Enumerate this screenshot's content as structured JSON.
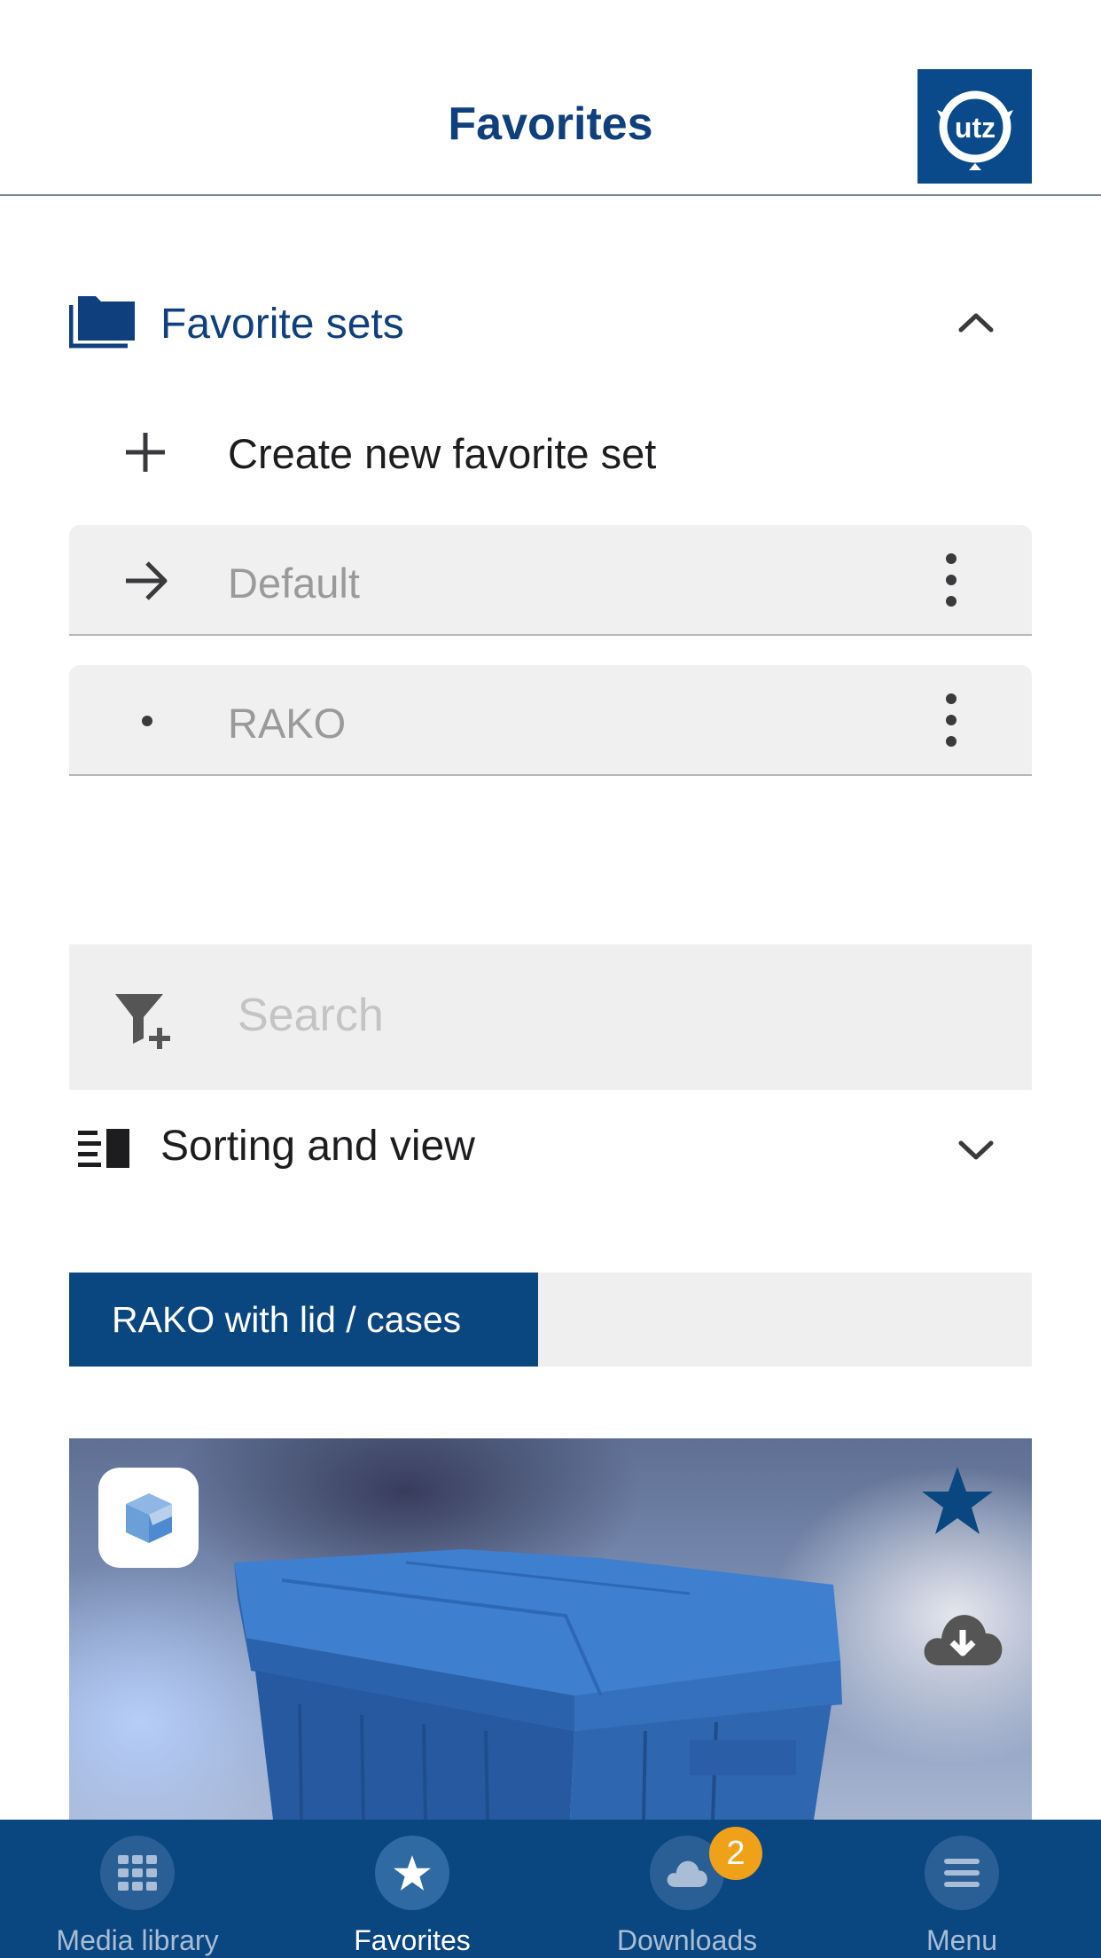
{
  "header": {
    "title": "Favorites",
    "logo_text": "utz"
  },
  "favorite_sets": {
    "title": "Favorite sets",
    "create_label": "Create new favorite set",
    "items": [
      {
        "label": "Default",
        "icon": "arrow-right-icon"
      },
      {
        "label": "RAKO",
        "icon": "bullet-icon"
      }
    ]
  },
  "search": {
    "placeholder": "Search",
    "value": ""
  },
  "sorting": {
    "label": "Sorting and view"
  },
  "category_tabs": [
    {
      "label": "RAKO with lid / cases",
      "active": true
    }
  ],
  "product_card": {
    "badge_icon": "3d-cube-icon",
    "favorite_icon": "star-icon",
    "download_icon": "cloud-download-icon"
  },
  "bottom_nav": {
    "items": [
      {
        "label": "Media library",
        "icon": "grid-icon"
      },
      {
        "label": "Favorites",
        "icon": "star-icon",
        "active": true
      },
      {
        "label": "Downloads",
        "icon": "cloud-icon",
        "badge": "2"
      },
      {
        "label": "Menu",
        "icon": "hamburger-icon"
      }
    ]
  },
  "colors": {
    "brand_blue": "#0a4680",
    "title_blue": "#0f3f7c",
    "badge_orange": "#f0a11a"
  }
}
